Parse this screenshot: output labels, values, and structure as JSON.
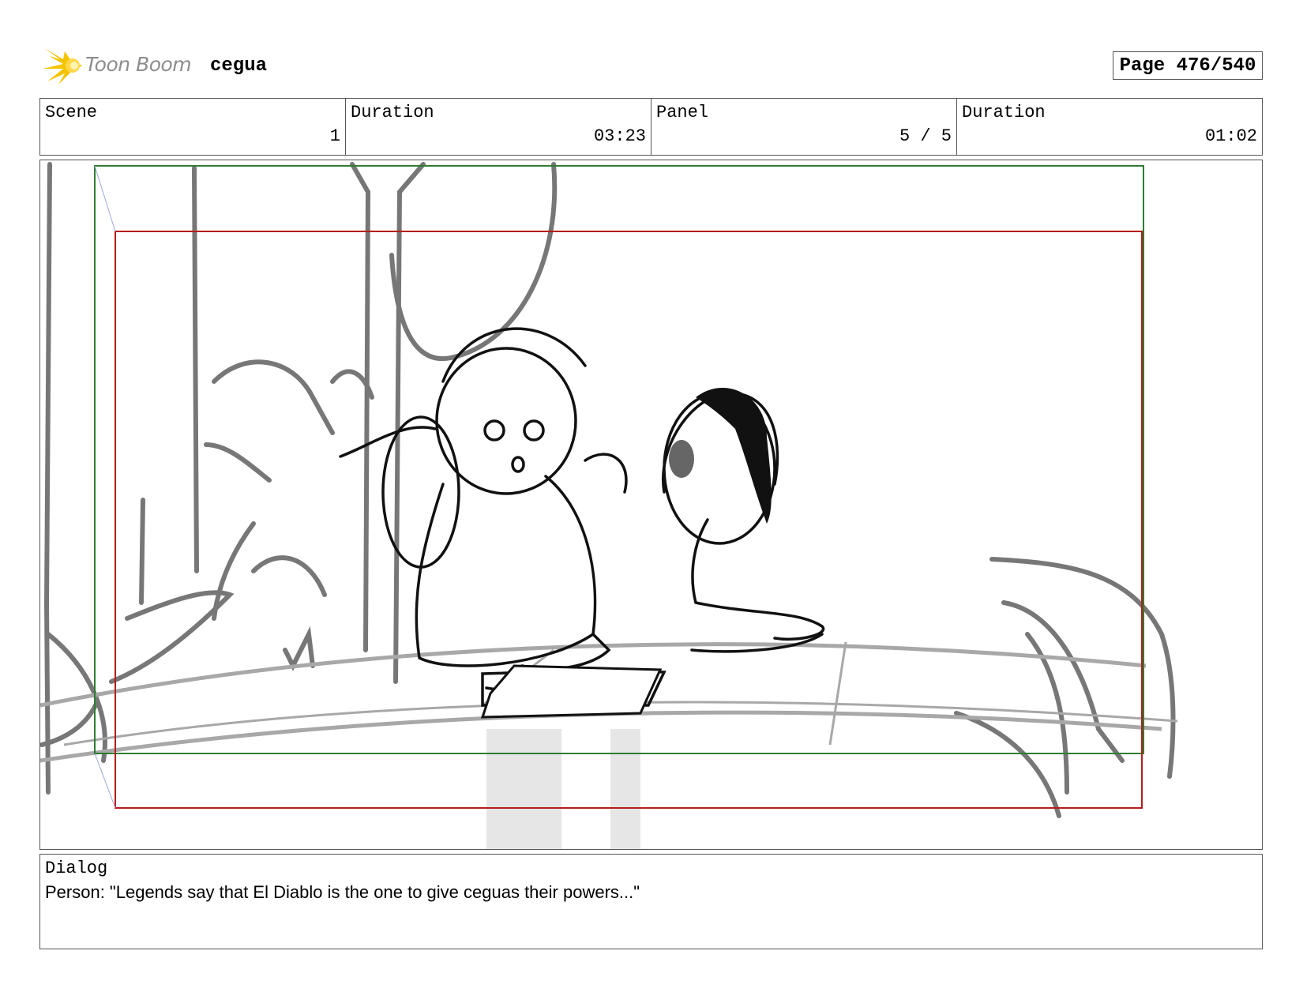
{
  "header": {
    "brand": "Toon Boom",
    "project": "cegua",
    "page": "Page 476/540"
  },
  "info": {
    "scene_label": "Scene",
    "scene_value": "1",
    "scene_duration_label": "Duration",
    "scene_duration_value": "03:23",
    "panel_label": "Panel",
    "panel_value": "5 / 5",
    "panel_duration_label": "Duration",
    "panel_duration_value": "01:02"
  },
  "dialog": {
    "label": "Dialog",
    "text": "Person: \"Legends say that El Diablo is the one to give ceguas their powers...\""
  },
  "colors": {
    "safe_frame": "#2e7d32",
    "camera_frame": "#b71c1c",
    "sketch_gray": "#777777",
    "logo_yellow": "#f5c400"
  }
}
